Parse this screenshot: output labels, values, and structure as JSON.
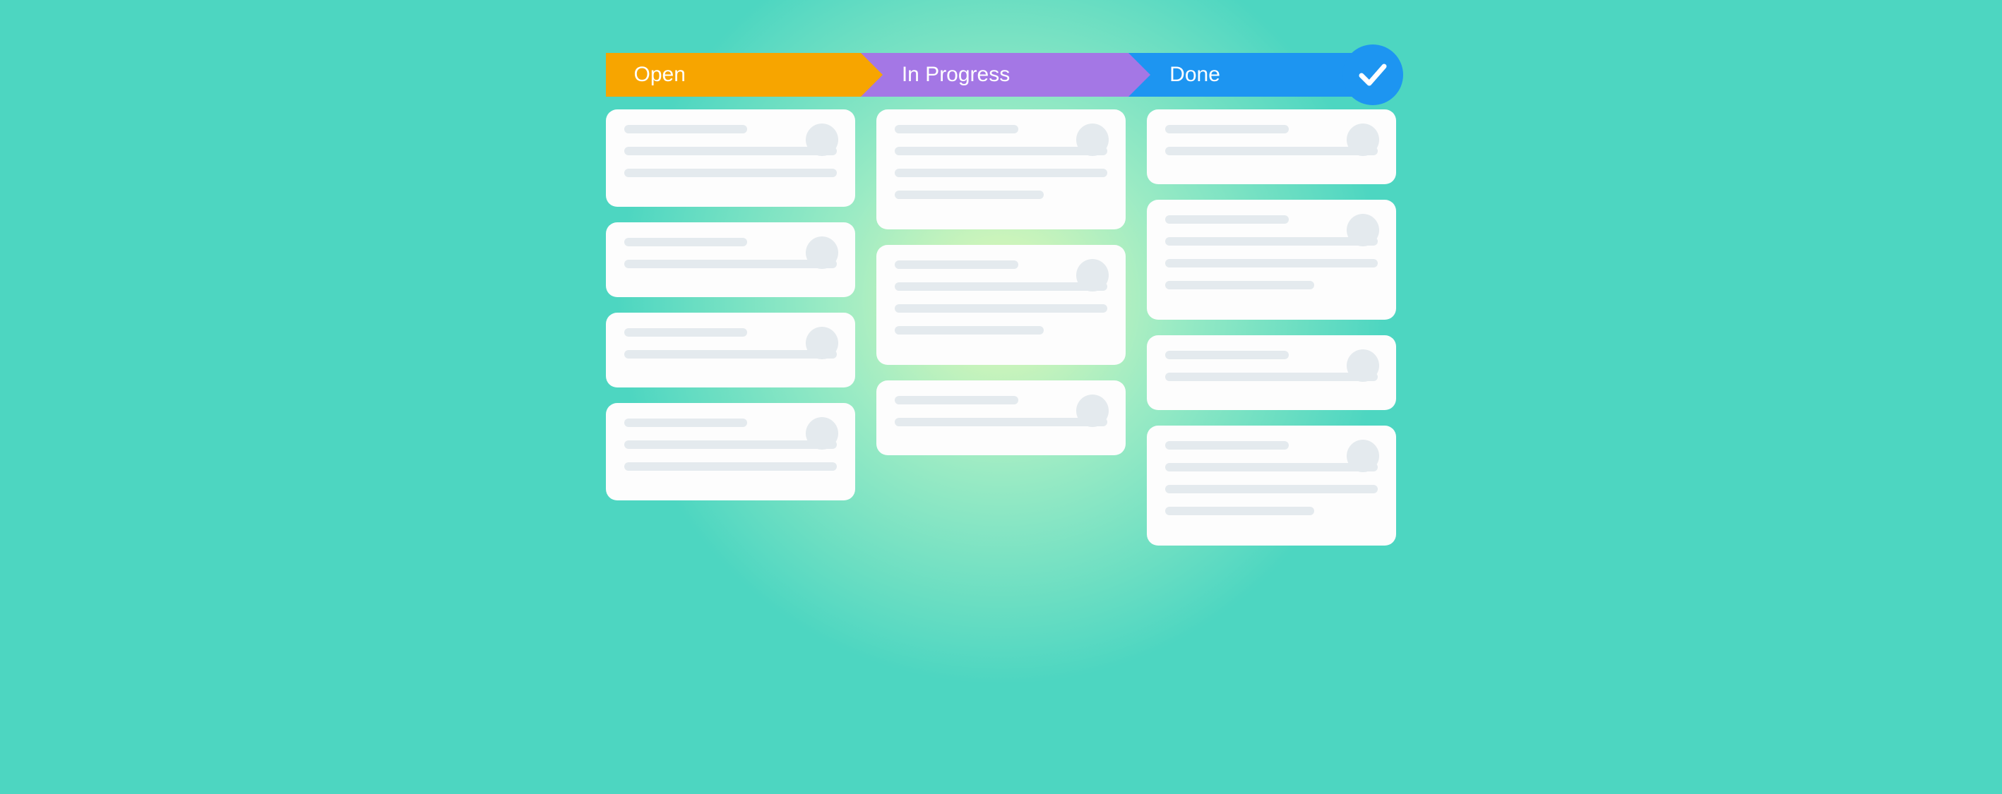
{
  "board": {
    "columns": [
      {
        "key": "open",
        "label": "Open",
        "color": "#f7a500",
        "cards": [
          {
            "lines": 3
          },
          {
            "lines": 2
          },
          {
            "lines": 2
          },
          {
            "lines": 3
          }
        ]
      },
      {
        "key": "in_progress",
        "label": "In Progress",
        "color": "#a477e5",
        "cards": [
          {
            "lines": 4
          },
          {
            "lines": 4
          },
          {
            "lines": 2
          }
        ]
      },
      {
        "key": "done",
        "label": "Done",
        "color": "#1d95f1",
        "badge": "checkmark",
        "cards": [
          {
            "lines": 2
          },
          {
            "lines": 4
          },
          {
            "lines": 2
          },
          {
            "lines": 4
          }
        ]
      }
    ]
  }
}
